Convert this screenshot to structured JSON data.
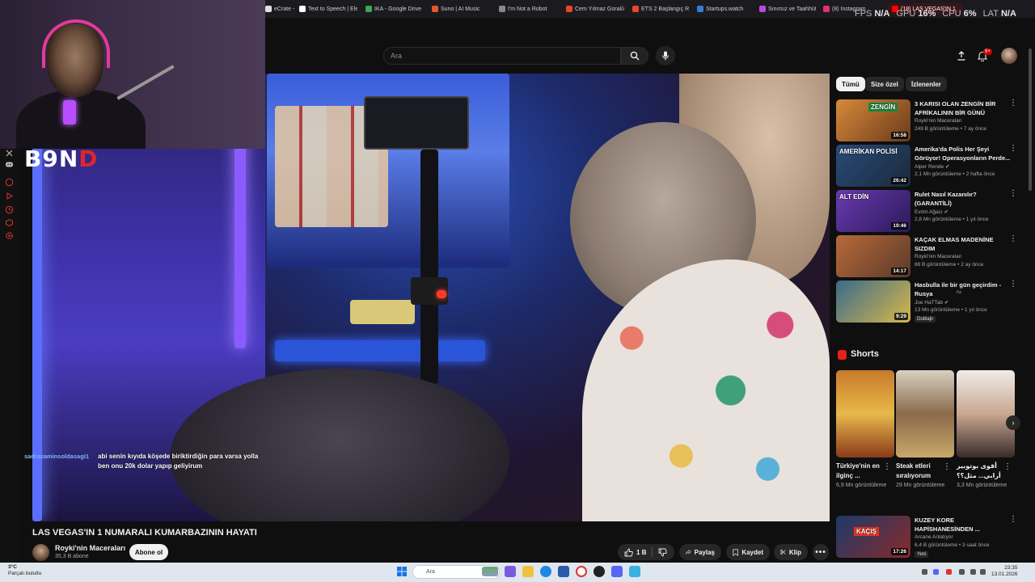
{
  "browser_tabs": [
    {
      "label": "eCrate - M",
      "color": "#e0e0e0"
    },
    {
      "label": "Text to Speech | Elev",
      "color": "#ffffff"
    },
    {
      "label": "IKA - Google Drive",
      "color": "#3aa757"
    },
    {
      "label": "Suno | AI Music",
      "color": "#e05a2a"
    },
    {
      "label": "I'm Not a Robot",
      "color": "#888888"
    },
    {
      "label": "Cem Yılmaz Goral/Ar",
      "color": "#e8452c"
    },
    {
      "label": "ETS 2 Başlangıç Reh",
      "color": "#e8452c"
    },
    {
      "label": "Startups.watch",
      "color": "#3a7bd5"
    },
    {
      "label": "Sınırsız ve Taahhüts",
      "color": "#b74be0"
    },
    {
      "label": "(8) Instagram",
      "color": "#e1306c"
    },
    {
      "label": "(18) LAS VEGAS'IN 1",
      "color": "#ff0000"
    }
  ],
  "perf": {
    "fps_label": "FPS",
    "fps": "N/A",
    "gpu_label": "GPU",
    "gpu": "16%",
    "cpu_label": "CPU",
    "cpu": "6%",
    "lat_label": "LAT",
    "lat": "N/A"
  },
  "header": {
    "search_placeholder": "Ara",
    "notif_count": "9+"
  },
  "stream_logo": {
    "text": "B9N",
    "accent": "D"
  },
  "chat": {
    "user": "sadrazaminsoldasagi1",
    "message": "abi senin kıyıda köşede biriktirdiğin para varsa yolla ben onu 20k dolar yapıp geliyirum"
  },
  "video": {
    "title": "LAS VEGAS'IN 1 NUMARALI KUMARBAZININ HAYATI",
    "channel": "Royki'nin Maceraları",
    "subs": "35,3 B abone",
    "subscribe": "Abone ol",
    "likes": "1 B",
    "share": "Paylaş",
    "save": "Kaydet",
    "clip": "Klip"
  },
  "chips": [
    "Tümü",
    "Size özel",
    "İzlenenler"
  ],
  "recs": [
    {
      "title": "3 KARISI OLAN ZENGİN BİR AFRİKALININ BİR GÜNÜ",
      "channel": "Royki'nin Maceraları",
      "meta": "249 B görüntüleme • 7 ay önce",
      "dur": "16:58",
      "thumb_text": "ZENGİN",
      "verified": false
    },
    {
      "title": "Amerika'da Polis Her Şeyi Görüyor! Operasyonların Perde...",
      "channel": "Alper Rende",
      "meta": "2,1 Mn görüntüleme • 2 hafta önce",
      "dur": "26:42",
      "thumb_text": "AMERİKAN POLİSİ",
      "verified": true
    },
    {
      "title": "Rulet Nasıl Kazanılır? (GARANTİLİ)",
      "channel": "Evrim Ağacı",
      "meta": "2,8 Mn görüntüleme • 1 yıl önce",
      "dur": "19:46",
      "thumb_text": "ALT EDİN",
      "verified": true
    },
    {
      "title": "KAÇAK ELMAS MADENİNE SIZDIM",
      "channel": "Royki'nin Maceraları",
      "meta": "88 B görüntüleme • 2 ay önce",
      "dur": "14:17",
      "thumb_text": "",
      "verified": false
    },
    {
      "title": "Hasbulla ile bir gün geçirdim - Rusya",
      "channel": "Joe HaTTab",
      "meta": "13 Mn görüntüleme • 1 yıl önce",
      "dur": "9:29",
      "thumb_text": "",
      "verified": true,
      "badge": "Dublajlı",
      "title_suffix": "ru"
    },
    {
      "title": "KUZEY KORE HAPİSHANESİNDEN ...",
      "channel": "Arcane Anlatıyor",
      "meta": "6,4 B görüntüleme • 3 saat önce",
      "dur": "17:26",
      "thumb_text": "KAÇIŞ",
      "verified": false,
      "badge": "Yeni"
    }
  ],
  "shorts": {
    "title": "Shorts",
    "items": [
      {
        "title": "Türkiye'nin en ilginç ...",
        "views": "6,9 Mn görüntüleme"
      },
      {
        "title": "Steak etleri sıralıyorum",
        "views": "29 Mn görüntüleme"
      },
      {
        "title": "أقوى بوتوبير أرابي... مثل؟؟",
        "views": "3,3 Mn görüntüleme"
      }
    ]
  },
  "taskbar": {
    "temp": "3°C",
    "weather": "Parçalı bulutlu",
    "search": "Ara",
    "time": "23:35",
    "date": "13.01.2026"
  },
  "colors": {
    "yt_red": "#ff0000",
    "chip_selected": "#f1f1f1"
  }
}
